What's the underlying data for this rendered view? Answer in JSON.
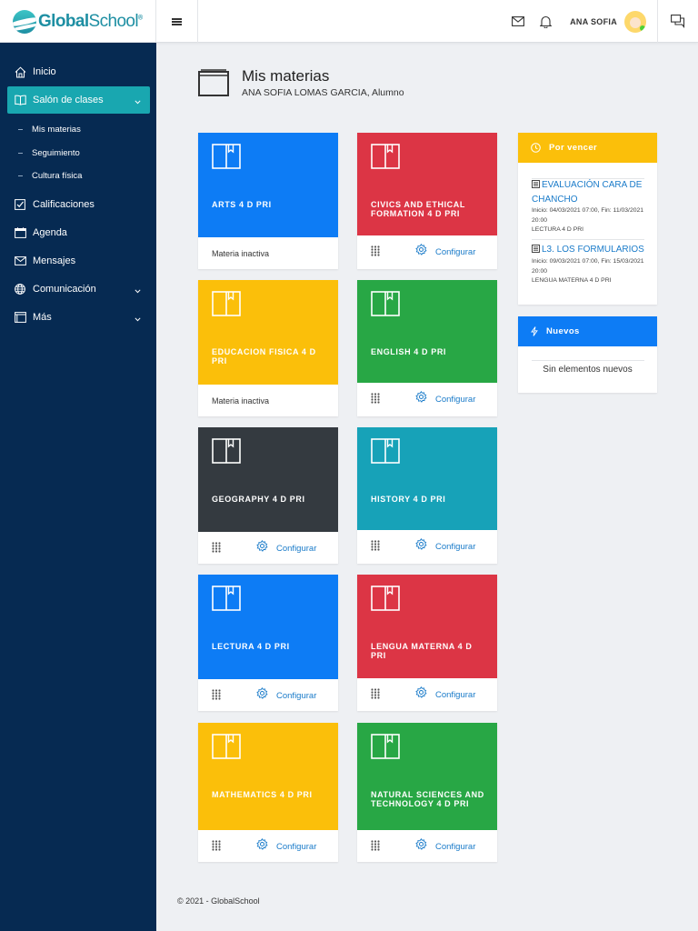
{
  "app": {
    "logo_bold": "Global",
    "logo_light": "School",
    "logo_mark": "®",
    "user_name": "ANA SOFIA"
  },
  "sidebar": {
    "items": [
      {
        "label": "Inicio",
        "icon": "home-icon"
      },
      {
        "label": "Salón de clases",
        "icon": "book-icon"
      },
      {
        "label": "Calificaciones",
        "icon": "checkbox-icon"
      },
      {
        "label": "Agenda",
        "icon": "calendar-icon"
      },
      {
        "label": "Mensajes",
        "icon": "mail-icon"
      },
      {
        "label": "Comunicación",
        "icon": "globe-icon"
      },
      {
        "label": "Más",
        "icon": "window-icon"
      }
    ],
    "subitems": [
      "Mis materias",
      "Seguimiento",
      "Cultura física"
    ]
  },
  "page": {
    "title": "Mis materias",
    "subtitle": "ANA SOFIA LOMAS GARCIA, Alumno"
  },
  "cards": [
    {
      "name": "ARTS 4 D PRI",
      "color": "#0d7cf5",
      "inactive": true
    },
    {
      "name": "CIVICS AND ETHICAL FORMATION 4 D PRI",
      "color": "#dc3545",
      "inactive": false
    },
    {
      "name": "EDUCACION FISICA 4 D PRI",
      "color": "#fbbf0a",
      "inactive": true
    },
    {
      "name": "ENGLISH 4 D PRI",
      "color": "#28a745",
      "inactive": false
    },
    {
      "name": "GEOGRAPHY 4 D PRI",
      "color": "#343a40",
      "inactive": false
    },
    {
      "name": "HISTORY 4 D PRI",
      "color": "#17a2b8",
      "inactive": false
    },
    {
      "name": "LECTURA 4 D PRI",
      "color": "#0d7cf5",
      "inactive": false
    },
    {
      "name": "LENGUA MATERNA 4 D PRI",
      "color": "#dc3545",
      "inactive": false
    },
    {
      "name": "MATHEMATICS 4 D PRI",
      "color": "#fbbf0a",
      "inactive": false
    },
    {
      "name": "NATURAL SCIENCES AND TECHNOLOGY 4 D PRI",
      "color": "#28a745",
      "inactive": false
    }
  ],
  "card_labels": {
    "inactive": "Materia inactiva",
    "configure": "Configurar"
  },
  "por_vencer": {
    "title": "Por vencer",
    "color": "#fbbf0a",
    "items": [
      {
        "title": "EVALUACIÓN CARA DE CHANCHO",
        "dates": "Inicio: 04/03/2021 07:00, Fin: 11/03/2021 20:00",
        "subject": "LECTURA 4 D PRI"
      },
      {
        "title": "L3. LOS FORMULARIOS",
        "dates": "Inicio: 09/03/2021 07:00, Fin: 15/03/2021 20:00",
        "subject": "LENGUA MATERNA 4 D PRI"
      }
    ]
  },
  "nuevos": {
    "title": "Nuevos",
    "color": "#0d7cf5",
    "empty": "Sin elementos nuevos"
  },
  "footer": "© 2021 - GlobalSchool"
}
